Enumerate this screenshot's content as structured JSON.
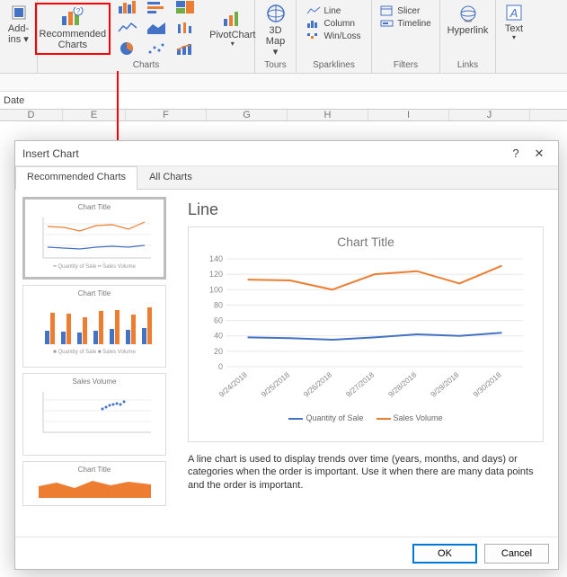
{
  "ribbon": {
    "addins_line1": "Add-",
    "addins_line2": "ins ▾",
    "recommended_line1": "Recommended",
    "recommended_line2": "Charts",
    "pivotchart_label": "PivotChart",
    "charts_group": "Charts",
    "map3d_line1": "3D",
    "map3d_line2": "Map ▾",
    "tours_group": "Tours",
    "spark_line": "Line",
    "spark_column": "Column",
    "spark_winloss": "Win/Loss",
    "sparklines_group": "Sparklines",
    "slicer": "Slicer",
    "timeline": "Timeline",
    "filters_group": "Filters",
    "hyperlink": "Hyperlink",
    "links_group": "Links",
    "text": "Text",
    "text_dd": "▾"
  },
  "strip_label": "Date",
  "columns": [
    "D",
    "E",
    "F",
    "G",
    "H",
    "I",
    "J"
  ],
  "dialog": {
    "title": "Insert Chart",
    "help": "?",
    "close": "✕",
    "tab_recommended": "Recommended Charts",
    "tab_all": "All Charts",
    "chart_type": "Line",
    "chart_title": "Chart Title",
    "desc": "A line chart is used to display trends over time (years, months, and days) or categories when the order is important. Use it when there are many data points and the order is important.",
    "ok": "OK",
    "cancel": "Cancel",
    "legend_a": "Quantity of Sale",
    "legend_b": "Sales Volume",
    "thumbs": {
      "t1": "Chart Title",
      "t2": "Chart Title",
      "t3": "Sales Volume",
      "t4": "Chart Title"
    }
  },
  "chart_data": {
    "type": "line",
    "title": "Chart Title",
    "x": [
      "9/24/2018",
      "9/25/2018",
      "9/26/2018",
      "9/27/2018",
      "9/28/2018",
      "9/29/2018",
      "9/30/2018"
    ],
    "series": [
      {
        "name": "Quantity of Sale",
        "color": "#4472c4",
        "values": [
          38,
          37,
          35,
          38,
          42,
          40,
          44
        ]
      },
      {
        "name": "Sales Volume",
        "color": "#ed7d31",
        "values": [
          113,
          112,
          100,
          120,
          124,
          108,
          131
        ]
      }
    ],
    "ylim": [
      0,
      140
    ],
    "yticks": [
      0,
      20,
      40,
      60,
      80,
      100,
      120,
      140
    ]
  }
}
